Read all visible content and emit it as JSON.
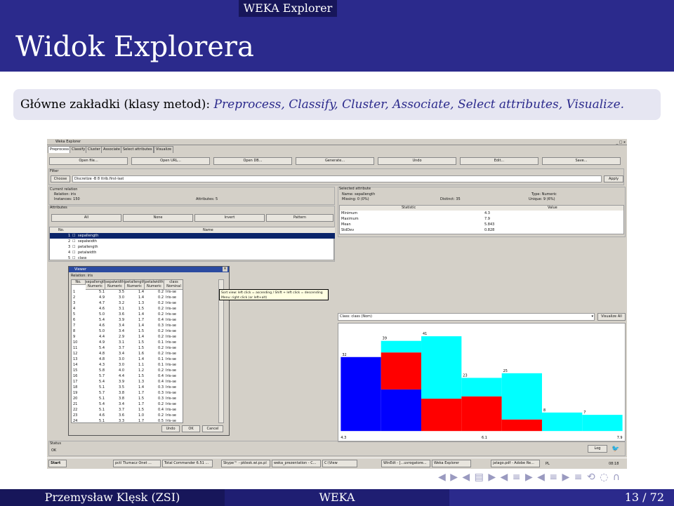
{
  "header": {
    "section": "WEKA Explorer",
    "title": "Widok Explorera"
  },
  "block": {
    "prefix": "Główne zakładki (klasy metod): ",
    "items": "Preprocess, Classify, Cluster, Associate, Select attributes, Visualize."
  },
  "weka": {
    "window_title": "Weka Explorer",
    "window_controls": "_ □ x",
    "tabs": [
      "Preprocess",
      "Classify",
      "Cluster",
      "Associate",
      "Select attributes",
      "Visualize"
    ],
    "buttons": [
      "Open file...",
      "Open URL...",
      "Open DB...",
      "Generate...",
      "Undo",
      "Edit...",
      "Save..."
    ],
    "filter": {
      "label": "Filter",
      "choose": "Choose",
      "value": "Discretize -B 8 ttrib.first-last",
      "apply": "Apply"
    },
    "current_relation": {
      "label": "Current relation",
      "relation": "Relation: iris",
      "instances": "Instances: 150",
      "attributes": "Attributes: 5"
    },
    "attributes_box": {
      "label": "Attributes",
      "buttons": [
        "All",
        "None",
        "Invert",
        "Pattern"
      ],
      "col_no": "No.",
      "col_name": "Name",
      "rows": [
        {
          "no": "1",
          "name": "sepallength"
        },
        {
          "no": "2",
          "name": "sepalwidth"
        },
        {
          "no": "3",
          "name": "petallength"
        },
        {
          "no": "4",
          "name": "petalwidth"
        },
        {
          "no": "5",
          "name": "class"
        }
      ]
    },
    "selected_attribute": {
      "label": "Selected attribute",
      "name": "Name: sepallength",
      "missing": "Missing: 0 (0%)",
      "distinct": "Distinct: 35",
      "type": "Type: Numeric",
      "unique": "Unique: 9 (6%)",
      "col_stat": "Statistic",
      "col_val": "Value",
      "stats": [
        {
          "s": "Minimum",
          "v": "4.3"
        },
        {
          "s": "Maximum",
          "v": "7.9"
        },
        {
          "s": "Mean",
          "v": "5.843"
        },
        {
          "s": "StdDev",
          "v": "0.828"
        }
      ]
    },
    "class_select": "Class: class (Nom)",
    "visualize_all": "Visualize All",
    "status": {
      "label": "Status",
      "value": "OK",
      "log": "Log"
    },
    "viewer": {
      "title": "Viewer",
      "relation": "Relation: iris",
      "headers": [
        {
          "n": "No.",
          "t": ""
        },
        {
          "n": "sepallength",
          "t": "Numeric"
        },
        {
          "n": "sepalwidth",
          "t": "Numeric"
        },
        {
          "n": "petallength",
          "t": "Numeric"
        },
        {
          "n": "petalwidth",
          "t": "Numeric"
        },
        {
          "n": "class",
          "t": "Nominal"
        }
      ],
      "rows": [
        [
          "1",
          "5.1",
          "3.5",
          "1.4",
          "0.2",
          "Iris-se"
        ],
        [
          "2",
          "4.9",
          "3.0",
          "1.4",
          "0.2",
          "Iris-se"
        ],
        [
          "3",
          "4.7",
          "3.2",
          "1.3",
          "0.2",
          "Iris-se"
        ],
        [
          "4",
          "4.6",
          "3.1",
          "1.5",
          "0.2",
          "Iris-se"
        ],
        [
          "5",
          "5.0",
          "3.6",
          "1.4",
          "0.2",
          "Iris-se"
        ],
        [
          "6",
          "5.4",
          "3.9",
          "1.7",
          "0.4",
          "Iris-se"
        ],
        [
          "7",
          "4.6",
          "3.4",
          "1.4",
          "0.3",
          "Iris-se"
        ],
        [
          "8",
          "5.0",
          "3.4",
          "1.5",
          "0.2",
          "Iris-se"
        ],
        [
          "9",
          "4.4",
          "2.9",
          "1.4",
          "0.2",
          "Iris-se"
        ],
        [
          "10",
          "4.9",
          "3.1",
          "1.5",
          "0.1",
          "Iris-se"
        ],
        [
          "11",
          "5.4",
          "3.7",
          "1.5",
          "0.2",
          "Iris-se"
        ],
        [
          "12",
          "4.8",
          "3.4",
          "1.6",
          "0.2",
          "Iris-se"
        ],
        [
          "13",
          "4.8",
          "3.0",
          "1.4",
          "0.1",
          "Iris-se"
        ],
        [
          "14",
          "4.3",
          "3.0",
          "1.1",
          "0.1",
          "Iris-se"
        ],
        [
          "15",
          "5.8",
          "4.0",
          "1.2",
          "0.2",
          "Iris-se"
        ],
        [
          "16",
          "5.7",
          "4.4",
          "1.5",
          "0.4",
          "Iris-se"
        ],
        [
          "17",
          "5.4",
          "3.9",
          "1.3",
          "0.4",
          "Iris-se"
        ],
        [
          "18",
          "5.1",
          "3.5",
          "1.4",
          "0.3",
          "Iris-se"
        ],
        [
          "19",
          "5.7",
          "3.8",
          "1.7",
          "0.3",
          "Iris-se"
        ],
        [
          "20",
          "5.1",
          "3.8",
          "1.5",
          "0.3",
          "Iris-se"
        ],
        [
          "21",
          "5.4",
          "3.4",
          "1.7",
          "0.2",
          "Iris-se"
        ],
        [
          "22",
          "5.1",
          "3.7",
          "1.5",
          "0.4",
          "Iris-se"
        ],
        [
          "23",
          "4.6",
          "3.6",
          "1.0",
          "0.2",
          "Iris-se"
        ],
        [
          "24",
          "5.1",
          "3.3",
          "1.7",
          "0.5",
          "Iris-se"
        ]
      ],
      "buttons": [
        "Undo",
        "OK",
        "Cancel"
      ]
    },
    "tooltip": [
      "Sort view: left click = ascending / Shift + left click = descending",
      "Menu: right click (or left+alt)"
    ],
    "histogram": {
      "x_labels": [
        "4.3",
        "6.1",
        "7.9"
      ],
      "bins": [
        {
          "label": "32",
          "blue": 32,
          "red": 0,
          "cyan": 0
        },
        {
          "label": "39",
          "blue": 18,
          "red": 16,
          "cyan": 5
        },
        {
          "label": "41",
          "blue": 0,
          "red": 14,
          "cyan": 27
        },
        {
          "label": "23",
          "blue": 0,
          "red": 15,
          "cyan": 8
        },
        {
          "label": "25",
          "blue": 0,
          "red": 5,
          "cyan": 20
        },
        {
          "label": "8",
          "blue": 0,
          "red": 0,
          "cyan": 8
        },
        {
          "label": "7",
          "blue": 0,
          "red": 0,
          "cyan": 7
        }
      ],
      "colors": {
        "blue": "#0000ff",
        "red": "#ff0000",
        "cyan": "#00ffff"
      }
    },
    "taskbar": [
      "Start",
      "pctl  Tlumacz  Onet ...",
      "Total Commander 6.51 ...",
      "Skype™ - pklesk.wi.ps.pl",
      "weka_prezentation - C...",
      "C:\\View",
      "WinEdt - [...uvrogatore...",
      "Weka Explorer",
      "jatago.pdf - Adobe Re...",
      "PL",
      "08:18"
    ]
  },
  "nav_symbols": "◀ ▶ ◀ ▤ ▶ ◀ ≡ ▶ ◀ ≡ ▶ ≡ ⟲ ◌ ∩",
  "footer": {
    "author": "Przemysław Klęsk (ZSI)",
    "title": "WEKA",
    "page": "13 / 72"
  },
  "colors": {
    "beamer_blue": "#2b2a8c",
    "beamer_dark": "#17165a",
    "selection": "#0a246a"
  }
}
